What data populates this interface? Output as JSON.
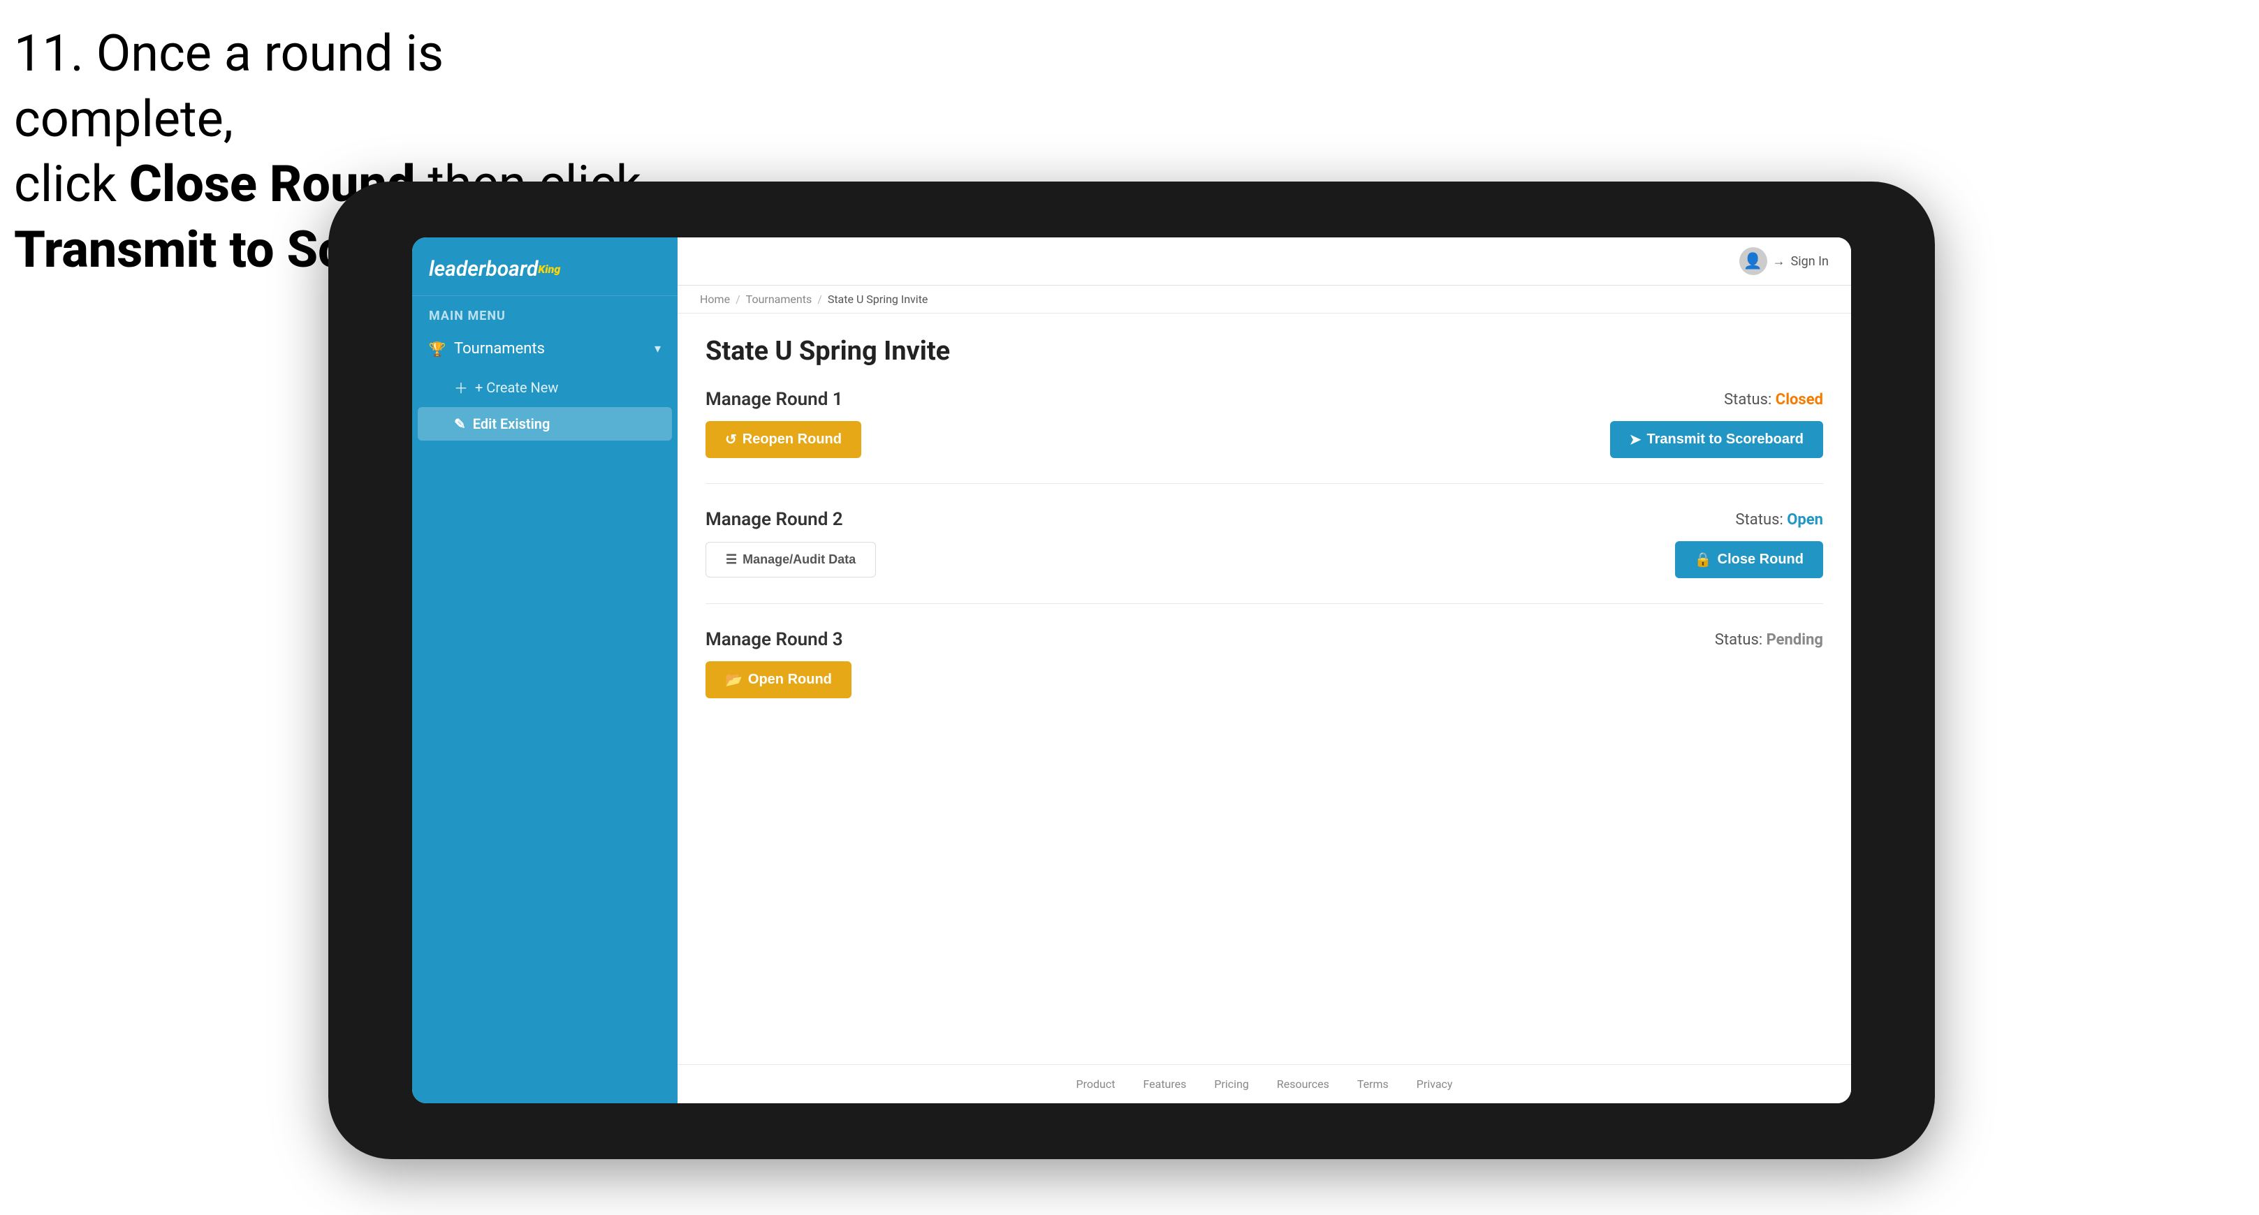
{
  "instruction": {
    "text_part1": "11. Once a round is complete,",
    "text_part2": "click ",
    "bold1": "Close Round",
    "text_part3": " then click",
    "bold2": "Transmit to Scoreboard."
  },
  "app": {
    "logo": {
      "part1": "leaderboard",
      "part2": "King"
    },
    "sidebar": {
      "menu_label": "MAIN MENU",
      "tournaments_label": "Tournaments",
      "create_new_label": "+ Create New",
      "edit_existing_label": "Edit Existing"
    },
    "topbar": {
      "sign_in_label": "Sign In"
    },
    "breadcrumb": {
      "home": "Home",
      "tournaments": "Tournaments",
      "current": "State U Spring Invite"
    },
    "page_title": "State U Spring Invite",
    "rounds": [
      {
        "title": "Manage Round 1",
        "status_label": "Status:",
        "status_value": "Closed",
        "status_class": "status-closed",
        "btn_left_label": "Reopen Round",
        "btn_right_label": "Transmit to Scoreboard",
        "btn_left_class": "btn-gold",
        "btn_right_class": "btn-blue",
        "show_audit": false
      },
      {
        "title": "Manage Round 2",
        "status_label": "Status:",
        "status_value": "Open",
        "status_class": "status-open",
        "btn_left_label": "Manage/Audit Data",
        "btn_right_label": "Close Round",
        "btn_left_class": "btn-outline",
        "btn_right_class": "btn-blue",
        "show_audit": true
      },
      {
        "title": "Manage Round 3",
        "status_label": "Status:",
        "status_value": "Pending",
        "status_class": "status-pending",
        "btn_left_label": "Open Round",
        "btn_right_label": "",
        "btn_left_class": "btn-gold",
        "btn_right_class": "",
        "show_audit": false
      }
    ],
    "footer": {
      "links": [
        "Product",
        "Features",
        "Pricing",
        "Resources",
        "Terms",
        "Privacy"
      ]
    }
  }
}
